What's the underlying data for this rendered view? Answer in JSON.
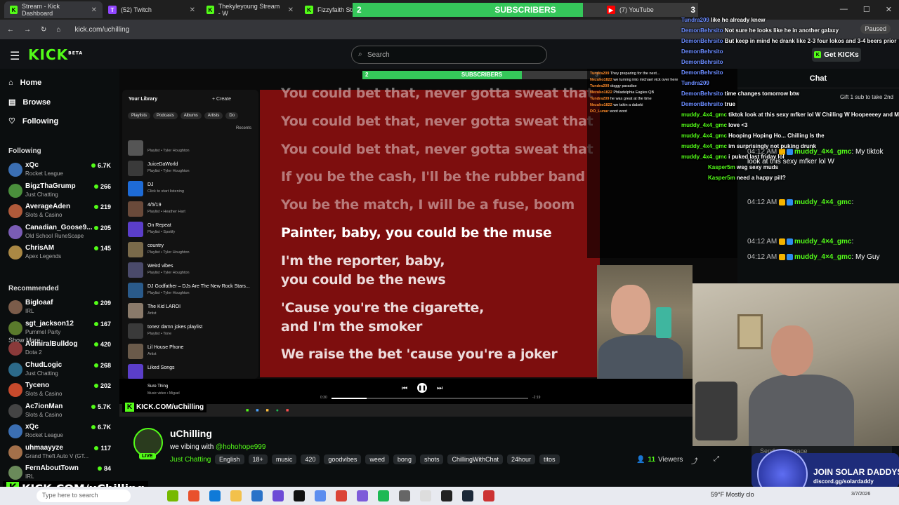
{
  "browser": {
    "tabs": [
      {
        "label": "Stream - Kick Dashboard",
        "icon": "K"
      },
      {
        "label": "(52) Twitch",
        "icon": "T"
      },
      {
        "label": "Thekyleyoung Stream - W",
        "icon": "K"
      },
      {
        "label": "Fizzyfaith Strea",
        "icon": "K"
      }
    ],
    "youtube_tab": "(7) YouTube",
    "url": "kick.com/uchilling",
    "paused": "Paused"
  },
  "subs_goal": {
    "label": "SUBSCRIBERS",
    "current": "2",
    "target": "3",
    "fill_fraction": 0.667
  },
  "nav": {
    "search_placeholder": "Search",
    "get_kicks": "Get KICKs"
  },
  "sidebar": {
    "home": "Home",
    "browse": "Browse",
    "following": "Following",
    "following_head": "Following",
    "show_more": "Show More",
    "recommended_head": "Recommended",
    "following_channels": [
      {
        "name": "xQc",
        "game": "Rocket League",
        "viewers": "6.7K",
        "color": "#3b6fb3"
      },
      {
        "name": "BigzThaGrump",
        "game": "Just Chatting",
        "viewers": "266",
        "color": "#4a8f3c"
      },
      {
        "name": "AverageAden",
        "game": "Slots & Casino",
        "viewers": "219",
        "color": "#b05a3a"
      },
      {
        "name": "Canadian_Goose9...",
        "game": "Old School RuneScape",
        "viewers": "205",
        "color": "#7a5cb5"
      },
      {
        "name": "ChrisAM",
        "game": "Apex Legends",
        "viewers": "145",
        "color": "#aa8844"
      }
    ],
    "recommended_channels": [
      {
        "name": "Bigloaaf",
        "game": "IRL",
        "viewers": "209",
        "color": "#7b5c4a"
      },
      {
        "name": "sgt_jackson12",
        "game": "Pummel Party",
        "viewers": "167",
        "color": "#5a7a2c"
      },
      {
        "name": "AdmiralBulldog",
        "game": "Dota 2",
        "viewers": "420",
        "color": "#8a3a3a"
      },
      {
        "name": "ChudLogic",
        "game": "Just Chatting",
        "viewers": "268",
        "color": "#2c6a8a"
      },
      {
        "name": "Tyceno",
        "game": "Slots & Casino",
        "viewers": "202",
        "color": "#c74a2c"
      },
      {
        "name": "Ac7ionMan",
        "game": "Slots & Casino",
        "viewers": "5.7K",
        "color": "#444"
      },
      {
        "name": "xQc",
        "game": "Rocket League",
        "viewers": "6.7K",
        "color": "#3b6fb3"
      },
      {
        "name": "uhmaayyze",
        "game": "Grand Theft Auto V (GT...",
        "viewers": "117",
        "color": "#a3704a"
      },
      {
        "name": "FernAboutTown",
        "game": "IRL",
        "viewers": "84",
        "color": "#6a8a5a"
      }
    ]
  },
  "spotify": {
    "library_title": "Your Library",
    "create": "+ Create",
    "chips": [
      "Playlists",
      "Podcasts",
      "Albums",
      "Artists",
      "Do"
    ],
    "recents": "Recents",
    "items": [
      {
        "title": "",
        "sub": "Playlist • Tyler Houghton",
        "color": "#555"
      },
      {
        "title": "JuiceDaWorld",
        "sub": "Playlist • Tyler Houghton",
        "color": "#3a3a3a"
      },
      {
        "title": "DJ",
        "sub": "Click to start listening",
        "color": "#1e6bd6"
      },
      {
        "title": "4/5/19",
        "sub": "Playlist • Heather Hart",
        "color": "#6a4a3a"
      },
      {
        "title": "On Repeat",
        "sub": "Playlist • Spotify",
        "color": "#5b3ec9"
      },
      {
        "title": "country",
        "sub": "Playlist • Tyler Houghton",
        "color": "#7a6a4a"
      },
      {
        "title": "Weird vibes",
        "sub": "Playlist • Tyler Houghton",
        "color": "#4a4a6a"
      },
      {
        "title": "DJ Godfather – DJs Are The New Rock Stars...",
        "sub": "Playlist • Tyler Houghton",
        "color": "#2a5a8a"
      },
      {
        "title": "The Kid LAROI",
        "sub": "Artist",
        "color": "#8a7a6a"
      },
      {
        "title": "tonez damn jokes playlist",
        "sub": "Playlist • Tone",
        "color": "#3a3a3a"
      },
      {
        "title": "Lil House Phone",
        "sub": "Artist",
        "color": "#6a5a4a"
      },
      {
        "title": "Liked Songs",
        "sub": "",
        "color": "#5b3ec9"
      }
    ],
    "now_playing_title": "Sure Thing",
    "now_playing_artist": "Music video • Miguel",
    "time_elapsed": "0:30",
    "time_remaining": "-2:19",
    "progress_fraction": 0.18,
    "lyrics_past": [
      "You could bet that, never gotta sweat that",
      "You could bet that, never gotta sweat that",
      "You could bet that, never gotta sweat that",
      "If you be the cash, I'll be the rubber band",
      "You be the match, I will be a fuse, boom"
    ],
    "lyrics_current": "Painter, baby, you could be the muse",
    "lyrics_future": [
      "I'm the reporter, baby,",
      "you could be the news",
      "'Cause you're the cigarette,",
      "and I'm the smoker",
      "We raise the bet 'cause you're a joker"
    ]
  },
  "stream_overlay": {
    "kick_url": "KICK.COM/uChilling",
    "inner_chat": [
      {
        "user": "Tundra209",
        "text": "They preparing for the next..."
      },
      {
        "user": "Nezuko1822",
        "text": "we turning into michael vick over here"
      },
      {
        "user": "Tundra209",
        "text": "doggy paradise"
      },
      {
        "user": "Nezuko1822",
        "text": "Philadelphia Eagles QB"
      },
      {
        "user": "Tundra209",
        "text": "he was great at the time"
      },
      {
        "user": "Nezuko1822",
        "text": "we takin a dabski"
      },
      {
        "user": "DO_Lunar",
        "text": "woot woot"
      }
    ]
  },
  "stream_info": {
    "username": "uChilling",
    "live": "LIVE",
    "title_prefix": "we vibing with",
    "title_mention": "@hohohope999",
    "category": "Just Chatting",
    "tags": [
      "English",
      "18+",
      "music",
      "420",
      "goodvibes",
      "weed",
      "bong",
      "shots",
      "ChillingWithChat",
      "24hour",
      "titos"
    ],
    "viewers": "11",
    "viewers_label": "Viewers"
  },
  "chat": {
    "header": "Chat",
    "pinned": "Gift 1 sub to take 2nd",
    "messages": [
      {
        "time": "04:12 AM",
        "user": "muddy_4×4_gmc",
        "text": "My tiktok look at this sexy mfker lol W"
      },
      {
        "time": "04:12 AM",
        "user": "muddy_4×4_gmc",
        "text": ""
      },
      {
        "time": "04:12 AM",
        "user": "muddy_4×4_gmc",
        "text": ""
      },
      {
        "time": "04:12 AM",
        "user": "muddy_4×4_gmc",
        "text": "My Guy"
      }
    ],
    "input_placeholder": "Send a message"
  },
  "overlay_chat": [
    {
      "user": "Tundra209",
      "text": "like he already knew"
    },
    {
      "user": "DemonBehrsito",
      "text": "Not sure he looks like he in another galaxy"
    },
    {
      "user": "DemonBehrsito",
      "text": "But keep in mind he drank like 2-3 four lokos and 3-4 beers prior"
    },
    {
      "user": "DemonBehrsito",
      "text": ""
    },
    {
      "user": "DemonBehrsito",
      "text": ""
    },
    {
      "user": "DemonBehrsito",
      "text": ""
    },
    {
      "user": "Tundra209",
      "text": ""
    },
    {
      "user": "DemonBehrsito",
      "text": "time changes tomorrow btw"
    },
    {
      "user": "DemonBehrsito",
      "text": "true"
    },
    {
      "user": "muddy_4x4_gmc",
      "text": "tiktok look at this sexy mfker lol W Chilling W Hoopeeeey and Miloooooooo"
    },
    {
      "user": "muddy_4x4_gmc",
      "text": "love <3"
    },
    {
      "user": "muddy_4x4_gmc",
      "text": "Hooping Hoping Ho... Chilling Is the"
    },
    {
      "user": "muddy_4x4_gmc",
      "text": "im surprisingly not puking drunk"
    },
    {
      "user": "muddy_4x4_gmc",
      "text": "i puked last friday lol"
    },
    {
      "user": "Kasper5m",
      "text": "wsg sexy muds"
    },
    {
      "user": "Kasper5m",
      "text": "need a happy pill?"
    }
  ],
  "promo": {
    "title": "JOIN SOLAR DADDYS",
    "link": "discord.gg/solardaddy"
  },
  "taskbar": {
    "search": "Type here to search",
    "weather": "59°F  Mostly clo",
    "date": "3/7/2026"
  }
}
